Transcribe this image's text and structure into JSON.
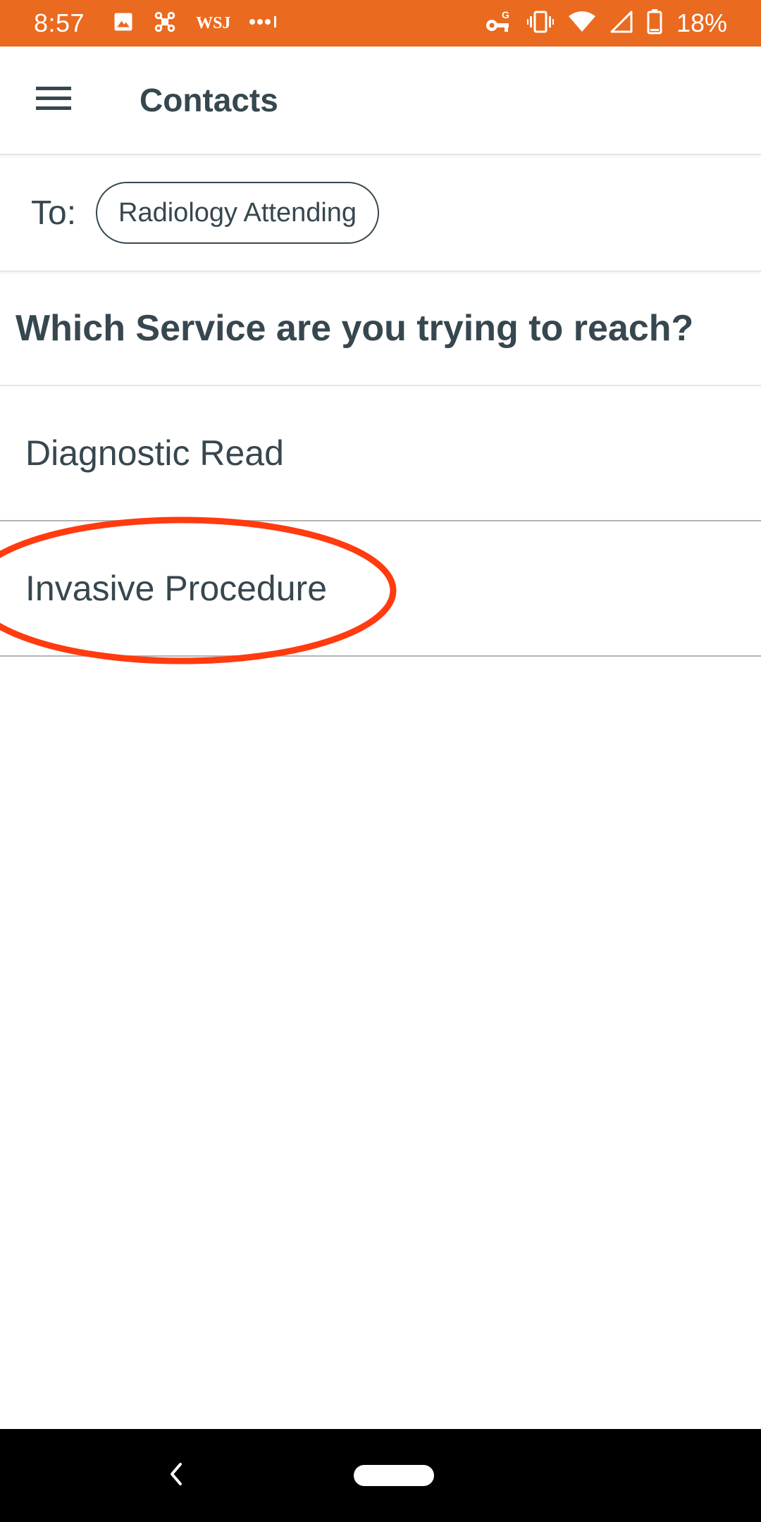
{
  "status_bar": {
    "time": "8:57",
    "left_icons": [
      "image-icon",
      "app-icon",
      "wsj-icon",
      "more-dots-icon"
    ],
    "wsj_label": "WSJ",
    "right_icons": [
      "vpn-key-icon",
      "vibrate-icon",
      "wifi-icon",
      "cell-signal-icon",
      "battery-icon"
    ],
    "battery_percent": "18%",
    "background_color": "#ea6a1f"
  },
  "app_bar": {
    "menu_icon": "hamburger-menu-icon",
    "title": "Contacts"
  },
  "recipient": {
    "to_label": "To:",
    "chip_label": "Radiology Attending"
  },
  "service_prompt": {
    "question": "Which Service are you trying to reach?"
  },
  "services": [
    {
      "label": "Diagnostic Read"
    },
    {
      "label": "Invasive Procedure"
    }
  ],
  "annotation": {
    "highlighted_item": "Invasive Procedure",
    "color": "#ff3b0f"
  },
  "nav_bar": {
    "back_icon": "back-chevron-icon",
    "home_icon": "home-pill-icon"
  }
}
